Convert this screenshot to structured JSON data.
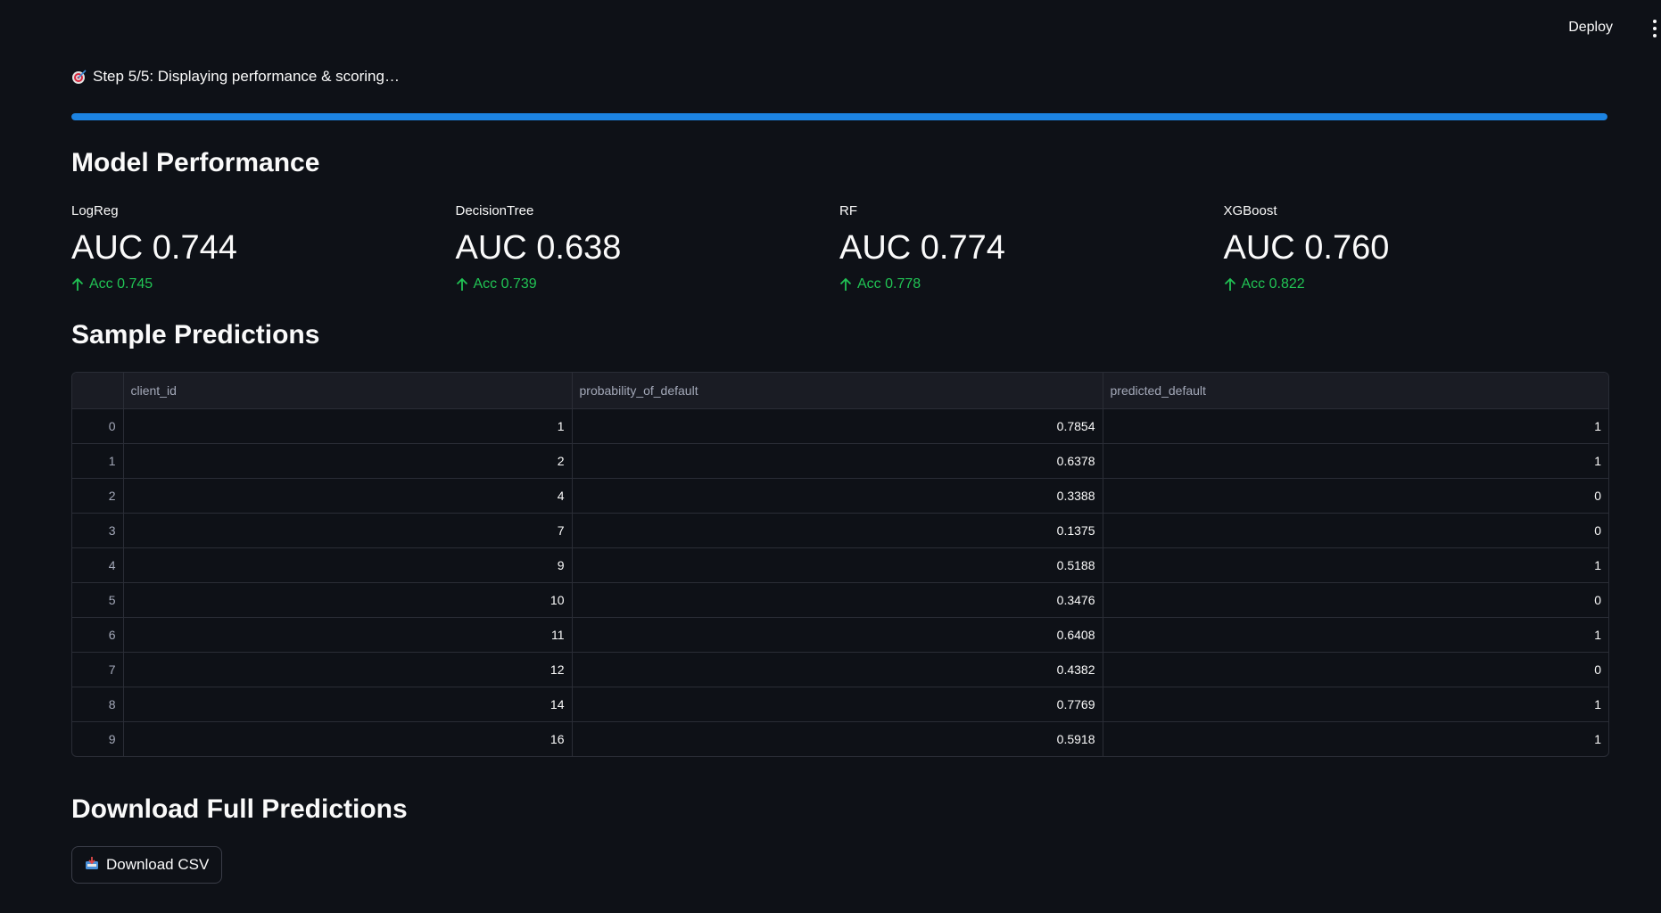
{
  "header": {
    "deploy_label": "Deploy",
    "menu_icon": "vertical-dots-icon"
  },
  "status": {
    "icon": "target-icon",
    "text": "Step 5/5: Displaying performance & scoring…",
    "progress_percent": 100,
    "progress_color": "#1c83e1"
  },
  "performance": {
    "title": "Model Performance",
    "metrics": [
      {
        "label": "LogReg",
        "value": "AUC 0.744",
        "delta": "Acc 0.745"
      },
      {
        "label": "DecisionTree",
        "value": "AUC 0.638",
        "delta": "Acc 0.739"
      },
      {
        "label": "RF",
        "value": "AUC 0.774",
        "delta": "Acc 0.778"
      },
      {
        "label": "XGBoost",
        "value": "AUC 0.760",
        "delta": "Acc 0.822"
      }
    ],
    "delta_color": "#21c354"
  },
  "sample": {
    "title": "Sample Predictions",
    "columns": [
      "client_id",
      "probability_of_default",
      "predicted_default"
    ],
    "rows": [
      {
        "index": "0",
        "client_id": "1",
        "probability_of_default": "0.7854",
        "predicted_default": "1"
      },
      {
        "index": "1",
        "client_id": "2",
        "probability_of_default": "0.6378",
        "predicted_default": "1"
      },
      {
        "index": "2",
        "client_id": "4",
        "probability_of_default": "0.3388",
        "predicted_default": "0"
      },
      {
        "index": "3",
        "client_id": "7",
        "probability_of_default": "0.1375",
        "predicted_default": "0"
      },
      {
        "index": "4",
        "client_id": "9",
        "probability_of_default": "0.5188",
        "predicted_default": "1"
      },
      {
        "index": "5",
        "client_id": "10",
        "probability_of_default": "0.3476",
        "predicted_default": "0"
      },
      {
        "index": "6",
        "client_id": "11",
        "probability_of_default": "0.6408",
        "predicted_default": "1"
      },
      {
        "index": "7",
        "client_id": "12",
        "probability_of_default": "0.4382",
        "predicted_default": "0"
      },
      {
        "index": "8",
        "client_id": "14",
        "probability_of_default": "0.7769",
        "predicted_default": "1"
      },
      {
        "index": "9",
        "client_id": "16",
        "probability_of_default": "0.5918",
        "predicted_default": "1"
      }
    ]
  },
  "download": {
    "title": "Download Full Predictions",
    "button_label": "Download CSV",
    "button_icon": "inbox-tray-icon"
  }
}
